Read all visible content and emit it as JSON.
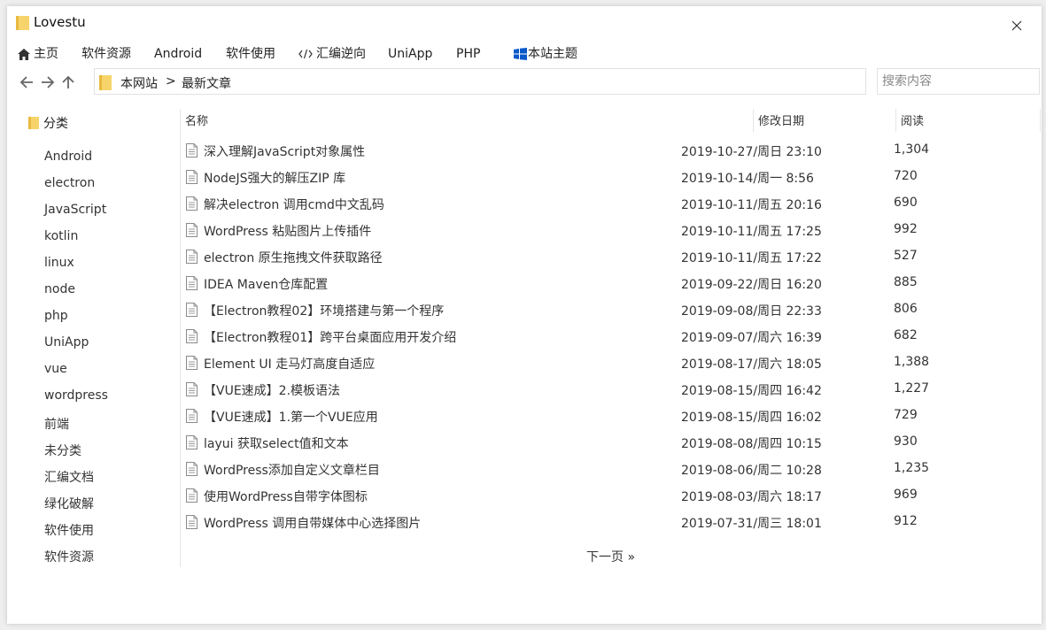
{
  "window": {
    "title": "Lovestu"
  },
  "menu": [
    {
      "label": "主页",
      "icon": "home-icon"
    },
    {
      "label": "软件资源"
    },
    {
      "label": "Android"
    },
    {
      "label": "软件使用"
    },
    {
      "label": "汇编逆向",
      "icon": "code-icon"
    },
    {
      "label": "UniApp"
    },
    {
      "label": "PHP"
    },
    {
      "label": "本站主题",
      "icon": "windows-icon"
    }
  ],
  "breadcrumb": [
    "本网站",
    ">",
    "最新文章"
  ],
  "search": {
    "placeholder": "搜索内容",
    "value": ""
  },
  "sidebar": {
    "header": "分类",
    "items": [
      "Android",
      "electron",
      "JavaScript",
      "kotlin",
      "linux",
      "node",
      "php",
      "UniApp",
      "vue",
      "wordpress",
      "前端",
      "未分类",
      "汇编文档",
      "绿化破解",
      "软件使用",
      "软件资源"
    ]
  },
  "table": {
    "columns": {
      "name": "名称",
      "date": "修改日期",
      "views": "阅读"
    },
    "rows": [
      {
        "name": "深入理解JavaScript对象属性",
        "date": "2019-10-27/周日 23:10",
        "views": "1,304"
      },
      {
        "name": "NodeJS强大的解压ZIP 库",
        "date": "2019-10-14/周一 8:56",
        "views": "720"
      },
      {
        "name": "解决electron 调用cmd中文乱码",
        "date": "2019-10-11/周五 20:16",
        "views": "690"
      },
      {
        "name": "WordPress 粘贴图片上传插件",
        "date": "2019-10-11/周五 17:25",
        "views": "992"
      },
      {
        "name": "electron 原生拖拽文件获取路径",
        "date": "2019-10-11/周五 17:22",
        "views": "527"
      },
      {
        "name": "IDEA Maven仓库配置",
        "date": "2019-09-22/周日 16:20",
        "views": "885"
      },
      {
        "name": "【Electron教程02】环境搭建与第一个程序",
        "date": "2019-09-08/周日 22:33",
        "views": "806"
      },
      {
        "name": "【Electron教程01】跨平台桌面应用开发介绍",
        "date": "2019-09-07/周六 16:39",
        "views": "682"
      },
      {
        "name": "Element UI 走马灯高度自适应",
        "date": "2019-08-17/周六 18:05",
        "views": "1,388"
      },
      {
        "name": "【VUE速成】2.模板语法",
        "date": "2019-08-15/周四 16:42",
        "views": "1,227"
      },
      {
        "name": "【VUE速成】1.第一个VUE应用",
        "date": "2019-08-15/周四 16:02",
        "views": "729"
      },
      {
        "name": "layui 获取select值和文本",
        "date": "2019-08-08/周四 10:15",
        "views": "930"
      },
      {
        "name": "WordPress添加自定义文章栏目",
        "date": "2019-08-06/周二 10:28",
        "views": "1,235"
      },
      {
        "name": "使用WordPress自带字体图标",
        "date": "2019-08-03/周六 18:17",
        "views": "969"
      },
      {
        "name": "WordPress 调用自带媒体中心选择图片",
        "date": "2019-07-31/周三 18:01",
        "views": "912"
      }
    ]
  },
  "pagination": {
    "next": "下一页 »"
  },
  "colors": {
    "folder": "#f7d46b",
    "folderDark": "#e8b93f",
    "windowsBlue": "#0a58ca"
  }
}
